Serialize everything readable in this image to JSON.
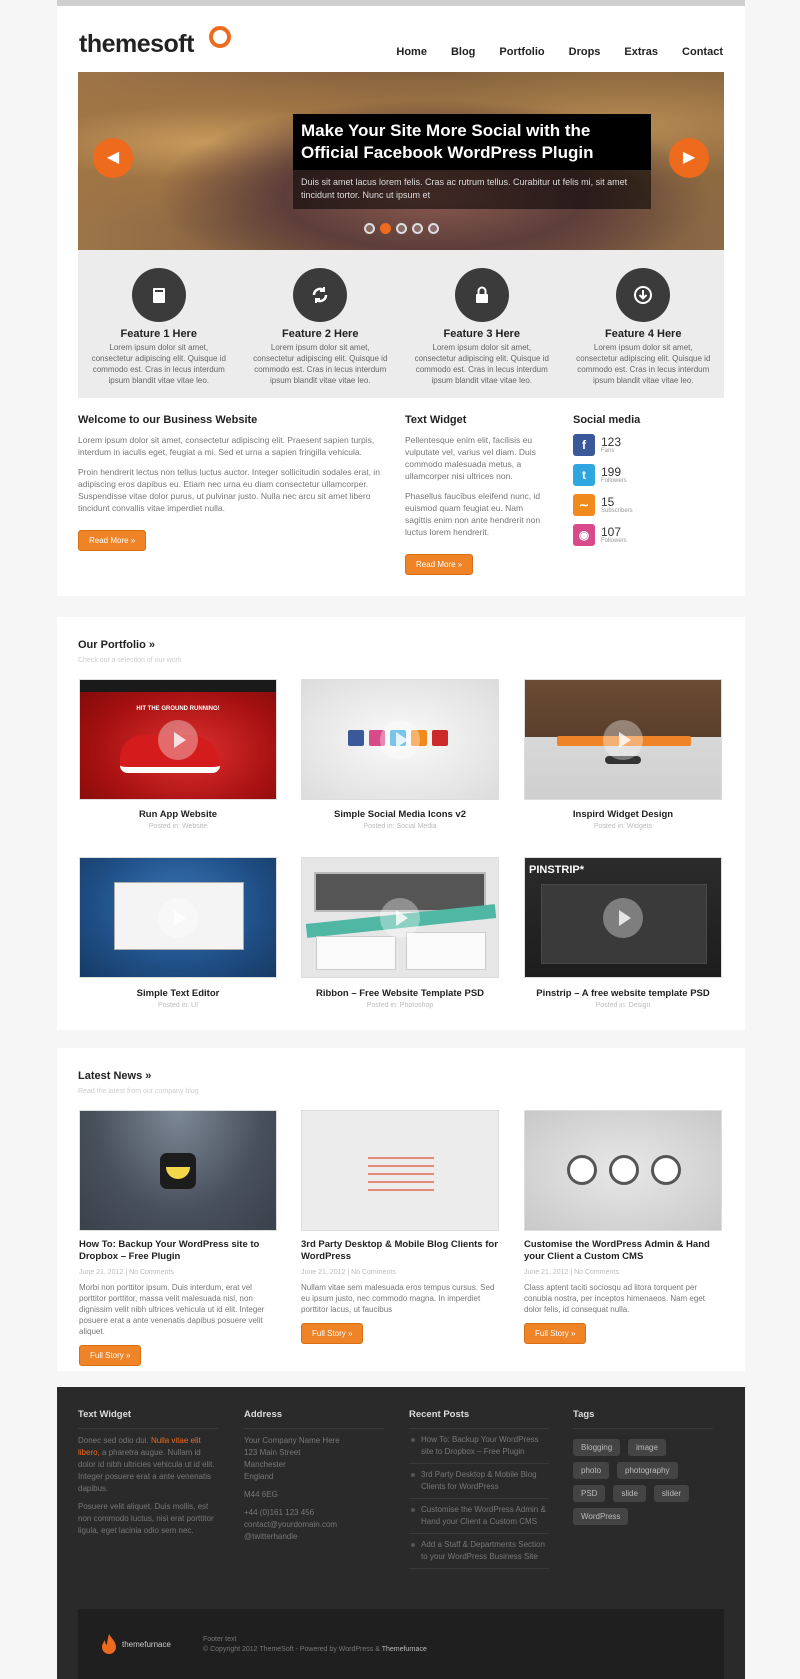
{
  "header": {
    "logo_main": "themesoft",
    "nav": [
      "Home",
      "Blog",
      "Portfolio",
      "Drops",
      "Extras",
      "Contact"
    ]
  },
  "slider": {
    "title": "Make Your Site More Social with the Official Facebook WordPress Plugin",
    "text": "Duis sit amet lacus lorem felis. Cras ac rutrum tellus. Curabitur ut felis mi, sit amet tincidunt tortor. Nunc ut ipsum et",
    "prev_icon": "arrow-left-icon",
    "next_icon": "arrow-right-icon",
    "active_dot": 2,
    "dot_count": 5
  },
  "features": [
    {
      "icon": "book-icon",
      "title": "Feature 1 Here",
      "text": "Lorem ipsum dolor sit amet, consectetur adipiscing elit. Quisque id commodo est. Cras in lecus interdum ipsum blandit vitae vitae leo."
    },
    {
      "icon": "refresh-icon",
      "title": "Feature 2 Here",
      "text": "Lorem ipsum dolor sit amet, consectetur adipiscing elit. Quisque id commodo est. Cras in lecus interdum ipsum blandit vitae vitae leo."
    },
    {
      "icon": "lock-icon",
      "title": "Feature 3 Here",
      "text": "Lorem ipsum dolor sit amet, consectetur adipiscing elit. Quisque id commodo est. Cras in lecus interdum ipsum blandit vitae vitae leo."
    },
    {
      "icon": "download-icon",
      "title": "Feature 4 Here",
      "text": "Lorem ipsum dolor sit amet, consectetur adipiscing elit. Quisque id commodo est. Cras in lecus interdum ipsum blandit vitae vitae leo."
    }
  ],
  "welcome": {
    "title": "Welcome to our Business Website",
    "p1": "Lorem ipsum dolor sit amet, consectetur adipiscing elit. Praesent sapien turpis, interdum in iaculis eget, feugiat a mi. Sed et urna a sapien fringilla vehicula.",
    "p2": "Proin hendrerit lectus non tellus luctus auctor. Integer sollicitudin sodales erat, in adipiscing eros dapibus eu. Etiam nec urna eu diam consectetur ullamcorper. Suspendisse vitae dolor purus, ut pulvinar justo. Nulla nec arcu sit amet libero tincidunt convallis vitae imperdiet nulla.",
    "button": "Read More »"
  },
  "text_widget": {
    "title": "Text Widget",
    "p1": "Pellentesque enim elit, facilisis eu vulputate vel, varius vel diam. Duis commodo malesuada metus, a ullamcorper nisi ultrices non.",
    "p2": "Phasellus faucibus eleifend nunc, id euismod quam feugiat eu. Nam sagittis enim non ante hendrerit non luctus lorem hendrerit.",
    "button": "Read More »"
  },
  "social": {
    "title": "Social media",
    "items": [
      {
        "icon": "facebook-icon",
        "count": "123",
        "label": "Fans",
        "color": "#3b5998"
      },
      {
        "icon": "twitter-icon",
        "count": "199",
        "label": "Followers",
        "color": "#2fa6e0"
      },
      {
        "icon": "rss-icon",
        "count": "15",
        "label": "Subscribers",
        "color": "#f08a1c"
      },
      {
        "icon": "dribbble-icon",
        "count": "107",
        "label": "Followers",
        "color": "#d84a8a"
      }
    ]
  },
  "portfolio": {
    "title": "Our Portfolio »",
    "subtitle": "Check out a selection of our work",
    "items": [
      {
        "name": "Run App Website",
        "meta": "Posted in: Website"
      },
      {
        "name": "Simple Social Media Icons v2",
        "meta": "Posted in: Social Media"
      },
      {
        "name": "Inspird Widget Design",
        "meta": "Posted in: Widgets"
      },
      {
        "name": "Simple Text Editor",
        "meta": "Posted in: UI"
      },
      {
        "name": "Ribbon – Free Website Template PSD",
        "meta": "Posted in: Photoshop"
      },
      {
        "name": "Pinstrip – A free website template PSD",
        "meta": "Posted in: Design"
      }
    ],
    "thumb_texts": {
      "run_tagline": "HIT THE GROUND RUNNING!",
      "pinstrip": "PINSTRIP*"
    }
  },
  "news": {
    "title": "Latest News »",
    "subtitle": "Read the latest from our company blog",
    "items": [
      {
        "title": "How To: Backup Your WordPress site to Dropbox – Free Plugin",
        "meta": "June 21, 2012 | No Comments",
        "text": "Morbi non porttitor ipsum. Duis interdum, erat vel porttitor porttitor, massa velit malesuada nisl, non dignissim velit nibh ultrices vehicula ut id elit. Integer posuere erat a ante venenatis dapibus posuere velit aliquet.",
        "button": "Full Story »"
      },
      {
        "title": "3rd Party Desktop & Mobile Blog Clients for WordPress",
        "meta": "June 21, 2012 | No Comments",
        "text": "Nullam vitae sem malesuada eros tempus cursus. Sed eu ipsum justo, nec commodo magna. In imperdiet porttitor lacus, ut faucibus",
        "button": "Full Story »"
      },
      {
        "title": "Customise the WordPress Admin & Hand your Client a Custom CMS",
        "meta": "June 21, 2012 | No Comments",
        "text": "Class aptent taciti sociosqu ad litora torquent per conubia nostra, per inceptos himenaeos. Nam eget dolor felis, id consequat nulla.",
        "button": "Full Story »"
      }
    ]
  },
  "footer": {
    "text_widget": {
      "title": "Text Widget",
      "p1_start": "Donec sed odio dui.",
      "p1_highlight": "Nulla vitae elit libero,",
      "p1_end": "a pharetra augue. Nullam id dolor id nibh ultricies vehicula ut id elit. Integer posuere erat a ante venenatis dapibus.",
      "p2": "Posuere velit aliquet. Duis mollis, est non commodo luctus, nisi erat porttitor ligula, eget lacinia odio sem nec."
    },
    "address": {
      "title": "Address",
      "lines": [
        "Your Company Name Here",
        "123 Main Street",
        "Manchester",
        "England",
        "M44 6EG",
        "+44 (0)161 123 456",
        "contact@yourdomain.com",
        "@twitterhandle"
      ]
    },
    "recent_posts": {
      "title": "Recent Posts",
      "items": [
        "How To: Backup Your WordPress site to Dropbox – Free Plugin",
        "3rd Party Desktop & Mobile Blog Clients for WordPress",
        "Customise the WordPress Admin & Hand your Client a Custom CMS",
        "Add a Staff & Departments Section to your WordPress Business Site"
      ]
    },
    "tags": {
      "title": "Tags",
      "items": [
        "Blogging",
        "image",
        "photo",
        "photography",
        "PSD",
        "slide",
        "slider",
        "WordPress"
      ]
    },
    "bottom": {
      "logo": "themefurnace",
      "footer_text": "Footer text",
      "copyright": "© Copyright 2012 ThemeSoft - Powered by WordPress &",
      "copyright_hl": "Themefurnace"
    }
  },
  "colors": {
    "accent": "#ee6a1c",
    "dark": "#2a2a2a"
  }
}
